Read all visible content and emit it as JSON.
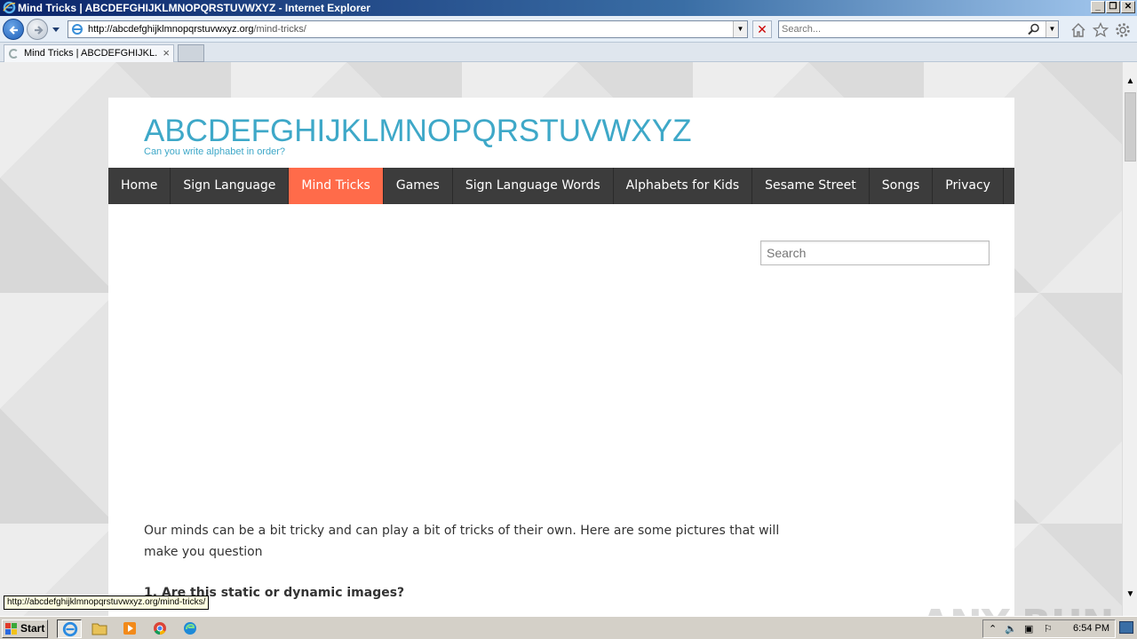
{
  "window": {
    "title": "Mind Tricks | ABCDEFGHIJKLMNOPQRSTUVWXYZ - Internet Explorer"
  },
  "address_bar": {
    "url_domain": "http://abcdefghijklmnopqrstuvwxyz.org",
    "url_path": "/mind-tricks/",
    "search_placeholder": "Search..."
  },
  "tabs": [
    {
      "label": "Mind Tricks | ABCDEFGHIJKL...",
      "close": "×"
    }
  ],
  "site": {
    "title": "ABCDEFGHIJKLMNOPQRSTUVWXYZ",
    "tagline": "Can you write alphabet in order?",
    "menu": [
      {
        "label": "Home",
        "active": false
      },
      {
        "label": "Sign Language",
        "active": false
      },
      {
        "label": "Mind Tricks",
        "active": true
      },
      {
        "label": "Games",
        "active": false
      },
      {
        "label": "Sign Language Words",
        "active": false
      },
      {
        "label": "Alphabets for Kids",
        "active": false
      },
      {
        "label": "Sesame Street",
        "active": false
      },
      {
        "label": "Songs",
        "active": false
      },
      {
        "label": "Privacy",
        "active": false
      }
    ],
    "search_placeholder": "Search",
    "intro": "Our minds can be a bit tricky and can play a bit of tricks of their own. Here are some pictures that will make you question",
    "heading1": "1. Are this static or dynamic images?"
  },
  "status_bar": {
    "link_url": "http://abcdefghijklmnopqrstuvwxyz.org/mind-tricks/"
  },
  "watermark": "ANY RUN",
  "taskbar": {
    "start_label": "Start",
    "clock": "6:54 PM",
    "apps": [
      "internet-explorer",
      "file-explorer",
      "media-player",
      "chrome",
      "edge"
    ]
  },
  "colors": {
    "accent": "#3ea8c8",
    "menu_bg": "#3c3c3c",
    "menu_active": "#ff6b4a"
  }
}
